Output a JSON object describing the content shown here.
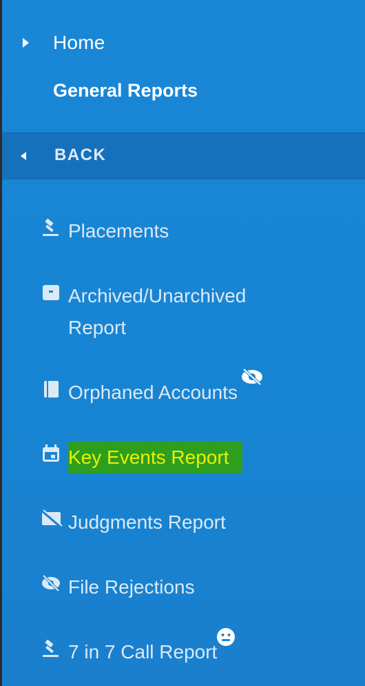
{
  "nav": {
    "home_label": "Home",
    "general_reports_label": "General Reports",
    "back_label": "BACK"
  },
  "menu": {
    "items": [
      {
        "label": "Placements",
        "icon": "gavel-icon"
      },
      {
        "label": "Archived/Unarchived Report",
        "icon": "archive-box-icon"
      },
      {
        "label": "Orphaned Accounts",
        "icon": "book-icon"
      },
      {
        "label": "Key Events Report",
        "icon": "calendar-icon",
        "highlighted": true
      },
      {
        "label": "Judgments Report",
        "icon": "no-card-icon"
      },
      {
        "label": "File Rejections",
        "icon": "eye-slash-icon"
      },
      {
        "label": "7 in 7 Call Report",
        "icon": "gavel-icon"
      }
    ]
  },
  "colors": {
    "panel": "#1a84d4",
    "back_bar": "#1671bc",
    "highlight_bg": "#2e9e1f",
    "highlight_text": "#e8f200"
  }
}
